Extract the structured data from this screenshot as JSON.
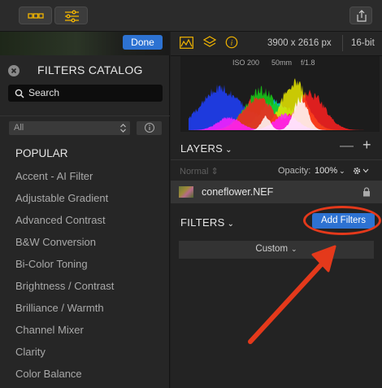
{
  "toolbar": {
    "buttons": [
      "layers-toggle-icon",
      "adjustments-icon"
    ],
    "share_icon": "share-icon"
  },
  "left": {
    "done_label": "Done",
    "catalog_title": "FILTERS CATALOG",
    "search_placeholder": "Search",
    "category_select": "All",
    "section_header": "POPULAR",
    "items": [
      "Accent - AI Filter",
      "Adjustable Gradient",
      "Advanced Contrast",
      "B&W Conversion",
      "Bi-Color Toning",
      "Brightness / Contrast",
      "Brilliance / Warmth",
      "Channel Mixer",
      "Clarity",
      "Color Balance"
    ]
  },
  "right": {
    "header_icons": [
      "histogram-icon",
      "layers-stack-icon",
      "info-icon"
    ],
    "dimensions": "3900 x 2616 px",
    "bit_depth": "16-bit",
    "histogram": {
      "iso": "ISO 200",
      "focal": "50mm",
      "aperture": "f/1.8"
    },
    "layers": {
      "title": "LAYERS",
      "blend_mode": "Normal",
      "opacity_label": "Opacity:",
      "opacity_value": "100%",
      "layer_name": "coneflower.NEF"
    },
    "filters": {
      "title": "FILTERS",
      "add_button": "Add Filters",
      "preset": "Custom"
    }
  },
  "colors": {
    "accent": "#2d72d2",
    "annotation": "#e4391b"
  }
}
